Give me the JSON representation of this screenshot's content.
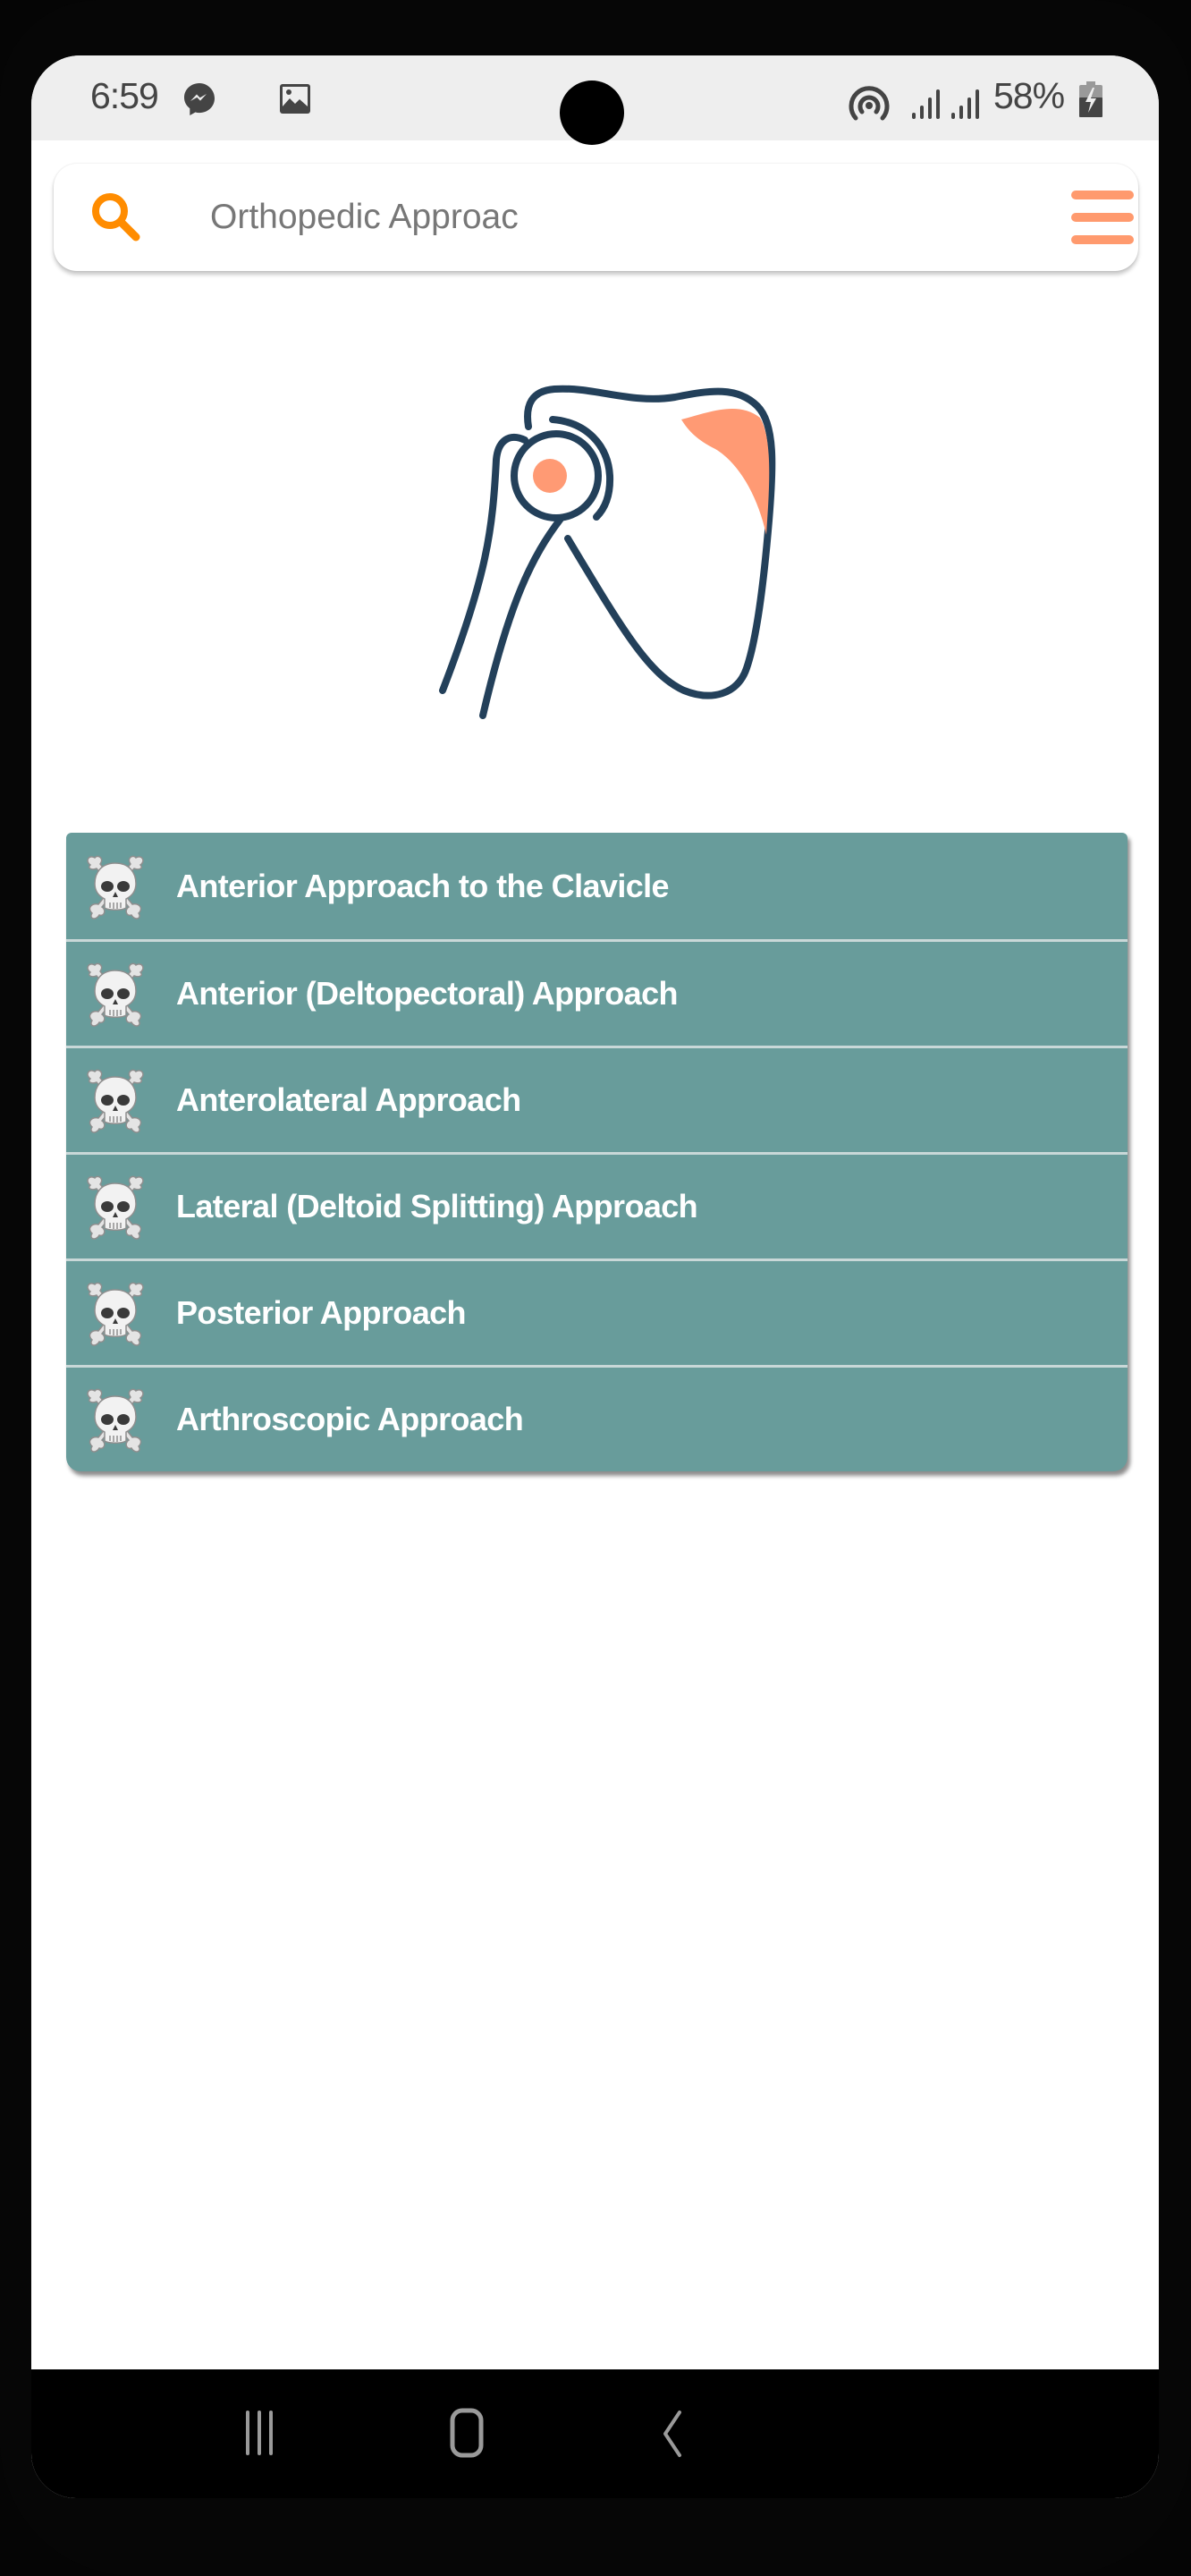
{
  "status_bar": {
    "time": "6:59",
    "battery_percent": "58%",
    "notification_icons": [
      "messenger-icon",
      "gallery-icon"
    ],
    "system_icons": [
      "hotspot-icon",
      "signal-icon",
      "signal-icon",
      "battery-charging-icon"
    ]
  },
  "search": {
    "placeholder": "Orthopedic Approac",
    "value": ""
  },
  "illustration": {
    "subject": "shoulder-joint-icon",
    "colors": {
      "outline": "#23405a",
      "accent": "#ff9a74"
    }
  },
  "approaches": [
    {
      "label": "Anterior Approach to the Clavicle",
      "icon": "skull-crossbones-icon"
    },
    {
      "label": "Anterior (Deltopectoral) Approach",
      "icon": "skull-crossbones-icon"
    },
    {
      "label": "Anterolateral Approach",
      "icon": "skull-crossbones-icon"
    },
    {
      "label": "Lateral (Deltoid Splitting) Approach",
      "icon": "skull-crossbones-icon"
    },
    {
      "label": "Posterior Approach",
      "icon": "skull-crossbones-icon"
    },
    {
      "label": "Arthroscopic Approach",
      "icon": "skull-crossbones-icon"
    }
  ],
  "theme": {
    "list_background": "#689c9b",
    "accent_orange": "#ff9a6e",
    "search_icon_color": "#ff8c00"
  },
  "nav_bar": {
    "buttons": [
      "recent-apps",
      "home",
      "back"
    ]
  }
}
